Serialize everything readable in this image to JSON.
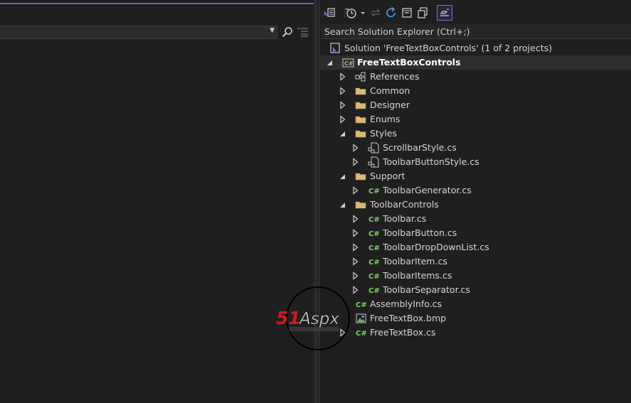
{
  "editor": {
    "navigation_combo_value": ""
  },
  "solution_explorer": {
    "search_placeholder": "Search Solution Explorer (Ctrl+;)",
    "toolbar_icons": [
      "vs-switch-view-icon",
      "pending-changes-icon",
      "dropdown-chevron-icon",
      "sync-icon",
      "refresh-icon",
      "collapse-all-icon",
      "show-all-files-icon",
      "properties-icon"
    ],
    "solution_label": "Solution 'FreeTextBoxControls' (1 of 2 projects)",
    "project_label": "FreeTextBoxControls",
    "items": [
      {
        "label": "References",
        "icon": "references-icon",
        "depth": 1,
        "expander": "collapsed"
      },
      {
        "label": "Common",
        "icon": "folder-icon",
        "depth": 1,
        "expander": "collapsed"
      },
      {
        "label": "Designer",
        "icon": "folder-icon",
        "depth": 1,
        "expander": "collapsed"
      },
      {
        "label": "Enums",
        "icon": "folder-icon",
        "depth": 1,
        "expander": "collapsed"
      },
      {
        "label": "Styles",
        "icon": "folder-icon",
        "depth": 1,
        "expander": "expanded"
      },
      {
        "label": "ScrollbarStyle.cs",
        "icon": "cs-component-icon",
        "depth": 2,
        "expander": "collapsed"
      },
      {
        "label": "ToolbarButtonStyle.cs",
        "icon": "cs-component-icon",
        "depth": 2,
        "expander": "collapsed"
      },
      {
        "label": "Support",
        "icon": "folder-icon",
        "depth": 1,
        "expander": "expanded"
      },
      {
        "label": "ToolbarGenerator.cs",
        "icon": "csharp-file-icon",
        "depth": 2,
        "expander": "collapsed"
      },
      {
        "label": "ToolbarControls",
        "icon": "folder-icon",
        "depth": 1,
        "expander": "expanded"
      },
      {
        "label": "Toolbar.cs",
        "icon": "csharp-file-icon",
        "depth": 2,
        "expander": "collapsed"
      },
      {
        "label": "ToolbarButton.cs",
        "icon": "csharp-file-icon",
        "depth": 2,
        "expander": "collapsed"
      },
      {
        "label": "ToolbarDropDownList.cs",
        "icon": "csharp-file-icon",
        "depth": 2,
        "expander": "collapsed"
      },
      {
        "label": "ToolbarItem.cs",
        "icon": "csharp-file-icon",
        "depth": 2,
        "expander": "collapsed"
      },
      {
        "label": "ToolbarItems.cs",
        "icon": "csharp-file-icon",
        "depth": 2,
        "expander": "collapsed"
      },
      {
        "label": "ToolbarSeparator.cs",
        "icon": "csharp-file-icon",
        "depth": 2,
        "expander": "collapsed"
      },
      {
        "label": "AssemblyInfo.cs",
        "icon": "csharp-file-icon",
        "depth": 1,
        "expander": "none"
      },
      {
        "label": "FreeTextBox.bmp",
        "icon": "bitmap-icon",
        "depth": 1,
        "expander": "none"
      },
      {
        "label": "FreeTextBox.cs",
        "icon": "csharp-file-icon",
        "depth": 1,
        "expander": "collapsed"
      }
    ]
  },
  "watermark": {
    "logo_text": "51Aspx"
  },
  "colors": {
    "background": "#1f1f1f",
    "accent": "#7e57c2",
    "csharp_green": "#7bd36a",
    "folder_tan": "#dcb67a",
    "selected_row": "#2e2e2e"
  }
}
